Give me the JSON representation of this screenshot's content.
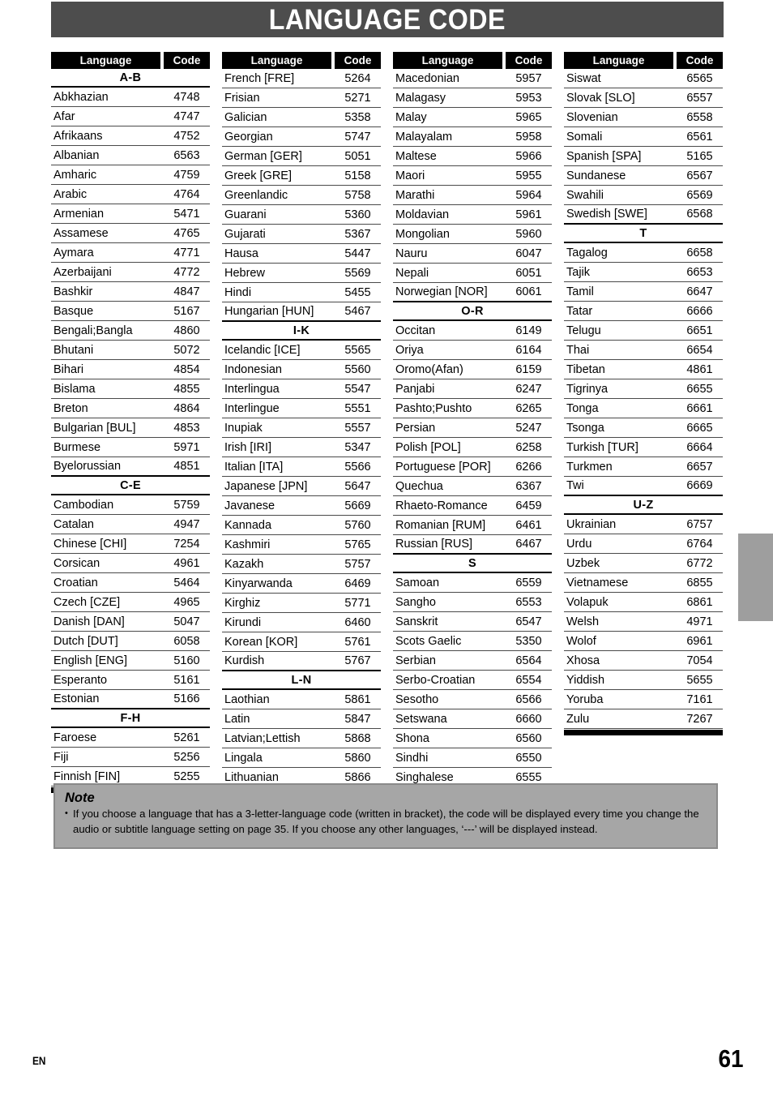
{
  "page": {
    "title": "LANGUAGE CODE",
    "footer_locale": "EN",
    "page_number": "61",
    "title_bar_color": "#4d4d4d",
    "note_box_color": "#a6a6a6",
    "side_tab_color": "#9e9e9e"
  },
  "table": {
    "header": {
      "language": "Language",
      "code": "Code"
    },
    "columns": [
      {
        "sections": [
          {
            "group": "A-B",
            "rows": [
              {
                "language": "Abkhazian",
                "code": "4748"
              },
              {
                "language": "Afar",
                "code": "4747"
              },
              {
                "language": "Afrikaans",
                "code": "4752"
              },
              {
                "language": "Albanian",
                "code": "6563"
              },
              {
                "language": "Amharic",
                "code": "4759"
              },
              {
                "language": "Arabic",
                "code": "4764"
              },
              {
                "language": "Armenian",
                "code": "5471"
              },
              {
                "language": "Assamese",
                "code": "4765"
              },
              {
                "language": "Aymara",
                "code": "4771"
              },
              {
                "language": "Azerbaijani",
                "code": "4772"
              },
              {
                "language": "Bashkir",
                "code": "4847"
              },
              {
                "language": "Basque",
                "code": "5167"
              },
              {
                "language": "Bengali;Bangla",
                "code": "4860"
              },
              {
                "language": "Bhutani",
                "code": "5072"
              },
              {
                "language": "Bihari",
                "code": "4854"
              },
              {
                "language": "Bislama",
                "code": "4855"
              },
              {
                "language": "Breton",
                "code": "4864"
              },
              {
                "language": "Bulgarian [BUL]",
                "code": "4853"
              },
              {
                "language": "Burmese",
                "code": "5971"
              },
              {
                "language": "Byelorussian",
                "code": "4851"
              }
            ]
          },
          {
            "group": "C-E",
            "rows": [
              {
                "language": "Cambodian",
                "code": "5759"
              },
              {
                "language": "Catalan",
                "code": "4947"
              },
              {
                "language": "Chinese [CHI]",
                "code": "7254"
              },
              {
                "language": "Corsican",
                "code": "4961"
              },
              {
                "language": "Croatian",
                "code": "5464"
              },
              {
                "language": "Czech [CZE]",
                "code": "4965"
              },
              {
                "language": "Danish [DAN]",
                "code": "5047"
              },
              {
                "language": "Dutch [DUT]",
                "code": "6058"
              },
              {
                "language": "English [ENG]",
                "code": "5160"
              },
              {
                "language": "Esperanto",
                "code": "5161"
              },
              {
                "language": "Estonian",
                "code": "5166"
              }
            ]
          },
          {
            "group": "F-H",
            "rows": [
              {
                "language": "Faroese",
                "code": "5261"
              },
              {
                "language": "Fiji",
                "code": "5256"
              },
              {
                "language": "Finnish [FIN]",
                "code": "5255"
              }
            ]
          }
        ]
      },
      {
        "sections": [
          {
            "group": "",
            "rows": [
              {
                "language": "French [FRE]",
                "code": "5264"
              },
              {
                "language": "Frisian",
                "code": "5271"
              },
              {
                "language": "Galician",
                "code": "5358"
              },
              {
                "language": "Georgian",
                "code": "5747"
              },
              {
                "language": "German [GER]",
                "code": "5051"
              },
              {
                "language": "Greek [GRE]",
                "code": "5158"
              },
              {
                "language": "Greenlandic",
                "code": "5758"
              },
              {
                "language": "Guarani",
                "code": "5360"
              },
              {
                "language": "Gujarati",
                "code": "5367"
              },
              {
                "language": "Hausa",
                "code": "5447"
              },
              {
                "language": "Hebrew",
                "code": "5569"
              },
              {
                "language": "Hindi",
                "code": "5455"
              },
              {
                "language": "Hungarian [HUN]",
                "code": "5467"
              }
            ]
          },
          {
            "group": "I-K",
            "rows": [
              {
                "language": "Icelandic [ICE]",
                "code": "5565"
              },
              {
                "language": "Indonesian",
                "code": "5560"
              },
              {
                "language": "Interlingua",
                "code": "5547"
              },
              {
                "language": "Interlingue",
                "code": "5551"
              },
              {
                "language": "Inupiak",
                "code": "5557"
              },
              {
                "language": "Irish [IRI]",
                "code": "5347"
              },
              {
                "language": "Italian [ITA]",
                "code": "5566"
              },
              {
                "language": "Japanese [JPN]",
                "code": "5647"
              },
              {
                "language": "Javanese",
                "code": "5669"
              },
              {
                "language": "Kannada",
                "code": "5760"
              },
              {
                "language": "Kashmiri",
                "code": "5765"
              },
              {
                "language": "Kazakh",
                "code": "5757"
              },
              {
                "language": "Kinyarwanda",
                "code": "6469"
              },
              {
                "language": "Kirghiz",
                "code": "5771"
              },
              {
                "language": "Kirundi",
                "code": "6460"
              },
              {
                "language": "Korean [KOR]",
                "code": "5761"
              },
              {
                "language": "Kurdish",
                "code": "5767"
              }
            ]
          },
          {
            "group": "L-N",
            "rows": [
              {
                "language": "Laothian",
                "code": "5861"
              },
              {
                "language": "Latin",
                "code": "5847"
              },
              {
                "language": "Latvian;Lettish",
                "code": "5868"
              },
              {
                "language": "Lingala",
                "code": "5860"
              },
              {
                "language": "Lithuanian",
                "code": "5866"
              }
            ]
          }
        ]
      },
      {
        "sections": [
          {
            "group": "",
            "rows": [
              {
                "language": "Macedonian",
                "code": "5957"
              },
              {
                "language": "Malagasy",
                "code": "5953"
              },
              {
                "language": "Malay",
                "code": "5965"
              },
              {
                "language": "Malayalam",
                "code": "5958"
              },
              {
                "language": "Maltese",
                "code": "5966"
              },
              {
                "language": "Maori",
                "code": "5955"
              },
              {
                "language": "Marathi",
                "code": "5964"
              },
              {
                "language": "Moldavian",
                "code": "5961"
              },
              {
                "language": "Mongolian",
                "code": "5960"
              },
              {
                "language": "Nauru",
                "code": "6047"
              },
              {
                "language": "Nepali",
                "code": "6051"
              },
              {
                "language": "Norwegian [NOR]",
                "code": "6061"
              }
            ]
          },
          {
            "group": "O-R",
            "rows": [
              {
                "language": "Occitan",
                "code": "6149"
              },
              {
                "language": "Oriya",
                "code": "6164"
              },
              {
                "language": "Oromo(Afan)",
                "code": "6159"
              },
              {
                "language": "Panjabi",
                "code": "6247"
              },
              {
                "language": "Pashto;Pushto",
                "code": "6265"
              },
              {
                "language": "Persian",
                "code": "5247"
              },
              {
                "language": "Polish [POL]",
                "code": "6258"
              },
              {
                "language": "Portuguese [POR]",
                "code": "6266"
              },
              {
                "language": "Quechua",
                "code": "6367"
              },
              {
                "language": "Rhaeto-Romance",
                "code": "6459"
              },
              {
                "language": "Romanian [RUM]",
                "code": "6461"
              },
              {
                "language": "Russian [RUS]",
                "code": "6467"
              }
            ]
          },
          {
            "group": "S",
            "rows": [
              {
                "language": "Samoan",
                "code": "6559"
              },
              {
                "language": "Sangho",
                "code": "6553"
              },
              {
                "language": "Sanskrit",
                "code": "6547"
              },
              {
                "language": "Scots Gaelic",
                "code": "5350"
              },
              {
                "language": "Serbian",
                "code": "6564"
              },
              {
                "language": "Serbo-Croatian",
                "code": "6554"
              },
              {
                "language": "Sesotho",
                "code": "6566"
              },
              {
                "language": "Setswana",
                "code": "6660"
              },
              {
                "language": "Shona",
                "code": "6560"
              },
              {
                "language": "Sindhi",
                "code": "6550"
              },
              {
                "language": "Singhalese",
                "code": "6555"
              }
            ]
          }
        ]
      },
      {
        "sections": [
          {
            "group": "",
            "rows": [
              {
                "language": "Siswat",
                "code": "6565"
              },
              {
                "language": "Slovak [SLO]",
                "code": "6557"
              },
              {
                "language": "Slovenian",
                "code": "6558"
              },
              {
                "language": "Somali",
                "code": "6561"
              },
              {
                "language": "Spanish [SPA]",
                "code": "5165"
              },
              {
                "language": "Sundanese",
                "code": "6567"
              },
              {
                "language": "Swahili",
                "code": "6569"
              },
              {
                "language": "Swedish [SWE]",
                "code": "6568"
              }
            ]
          },
          {
            "group": "T",
            "rows": [
              {
                "language": "Tagalog",
                "code": "6658"
              },
              {
                "language": "Tajik",
                "code": "6653"
              },
              {
                "language": "Tamil",
                "code": "6647"
              },
              {
                "language": "Tatar",
                "code": "6666"
              },
              {
                "language": "Telugu",
                "code": "6651"
              },
              {
                "language": "Thai",
                "code": "6654"
              },
              {
                "language": "Tibetan",
                "code": "4861"
              },
              {
                "language": "Tigrinya",
                "code": "6655"
              },
              {
                "language": "Tonga",
                "code": "6661"
              },
              {
                "language": "Tsonga",
                "code": "6665"
              },
              {
                "language": "Turkish [TUR]",
                "code": "6664"
              },
              {
                "language": "Turkmen",
                "code": "6657"
              },
              {
                "language": "Twi",
                "code": "6669"
              }
            ]
          },
          {
            "group": "U-Z",
            "rows": [
              {
                "language": "Ukrainian",
                "code": "6757"
              },
              {
                "language": "Urdu",
                "code": "6764"
              },
              {
                "language": "Uzbek",
                "code": "6772"
              },
              {
                "language": "Vietnamese",
                "code": "6855"
              },
              {
                "language": "Volapuk",
                "code": "6861"
              },
              {
                "language": "Welsh",
                "code": "4971"
              },
              {
                "language": "Wolof",
                "code": "6961"
              },
              {
                "language": "Xhosa",
                "code": "7054"
              },
              {
                "language": "Yiddish",
                "code": "5655"
              },
              {
                "language": "Yoruba",
                "code": "7161"
              },
              {
                "language": "Zulu",
                "code": "7267"
              }
            ]
          }
        ]
      }
    ]
  },
  "note": {
    "title": "Note",
    "bullet": "•",
    "text": "If you choose a language that has a 3-letter-language code (written in bracket), the code will be displayed every time you change the audio or subtitle language setting on page 35. If you choose any other languages, ‘---’ will be displayed instead."
  }
}
